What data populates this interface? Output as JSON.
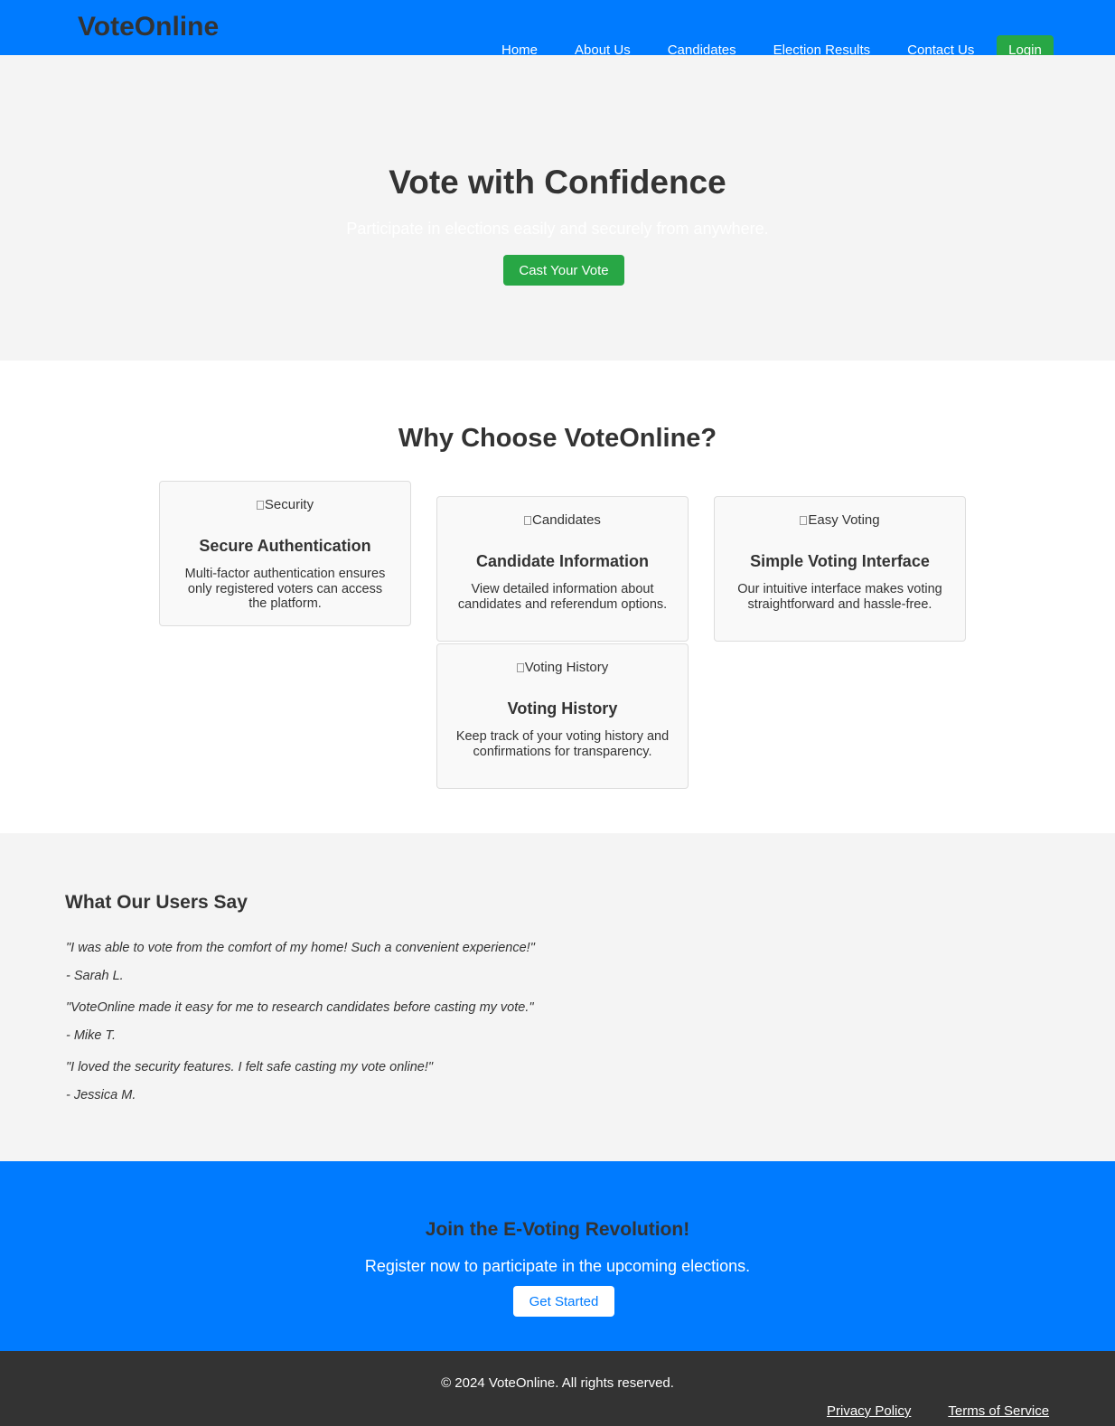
{
  "header": {
    "logo": "VoteOnline",
    "nav": [
      "Home",
      "About Us",
      "Candidates",
      "Election Results",
      "Contact Us"
    ],
    "login_label": "Login"
  },
  "hero": {
    "title": "Vote with Confidence",
    "subtitle": "Participate in elections easily and securely from anywhere.",
    "cta_label": "Cast Your Vote"
  },
  "features": {
    "title": "Why Choose VoteOnline?",
    "cards": [
      {
        "image_alt": "Security",
        "title": "Secure Authentication",
        "text": "Multi-factor authentication ensures only registered voters can access the platform."
      },
      {
        "image_alt": "Candidates",
        "title": "Candidate Information",
        "text": "View detailed information about candidates and referendum options."
      },
      {
        "image_alt": "Easy Voting",
        "title": "Simple Voting Interface",
        "text": "Our intuitive interface makes voting straightforward and hassle-free."
      },
      {
        "image_alt": "Voting History",
        "title": "Voting History",
        "text": "Keep track of your voting history and confirmations for transparency."
      }
    ]
  },
  "testimonials": {
    "title": "What Our Users Say",
    "items": [
      {
        "quote": "\"I was able to vote from the comfort of my home! Such a convenient experience!\"",
        "author": "- Sarah L."
      },
      {
        "quote": "\"VoteOnline made it easy for me to research candidates before casting my vote.\"",
        "author": "- Mike T."
      },
      {
        "quote": "\"I loved the security features. I felt safe casting my vote online!\"",
        "author": "- Jessica M."
      }
    ]
  },
  "join": {
    "title": "Join the E-Voting Revolution!",
    "text": "Register now to participate in the upcoming elections.",
    "cta_label": "Get Started"
  },
  "footer": {
    "copyright": "© 2024 VoteOnline. All rights reserved.",
    "links": [
      "Privacy Policy",
      "Terms of Service"
    ]
  },
  "colors": {
    "brand_blue": "#007bff",
    "accent_green": "#28a745",
    "light_bg": "#f4f4f4",
    "footer_bg": "#333333"
  }
}
